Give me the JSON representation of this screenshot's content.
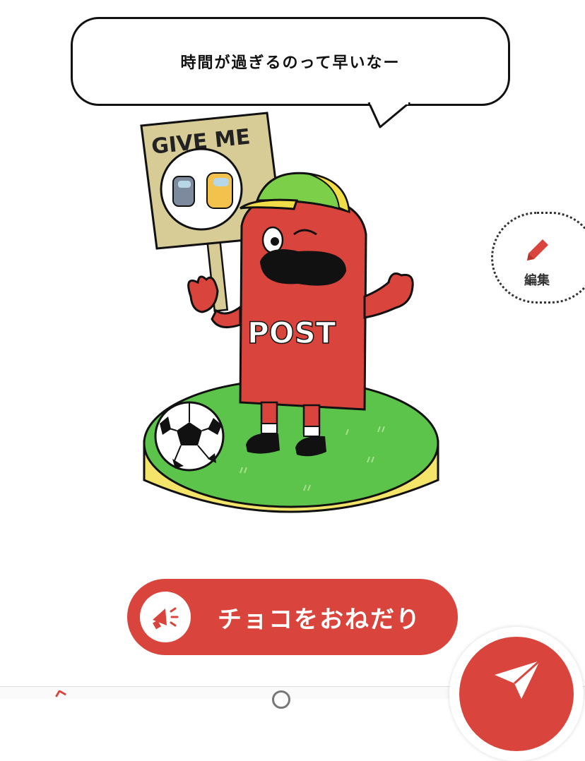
{
  "speech_bubble": {
    "text": "時間が過ぎるのって早いなー"
  },
  "illustration": {
    "sign_text": "GIVE ME",
    "body_text": "POST"
  },
  "edit_button": {
    "label": "編集"
  },
  "cta_button": {
    "label": "チョコをおねだり"
  },
  "colors": {
    "accent_red": "#d9453d",
    "grass_green": "#5cc44a",
    "base_yellow": "#f4e46a",
    "cap_yellow": "#f0dd47",
    "cap_green": "#7ccf48",
    "sign_tan": "#d8cc96"
  },
  "icons": {
    "edit": "pencil-icon",
    "cta": "megaphone-icon",
    "fab": "paper-plane-icon"
  }
}
